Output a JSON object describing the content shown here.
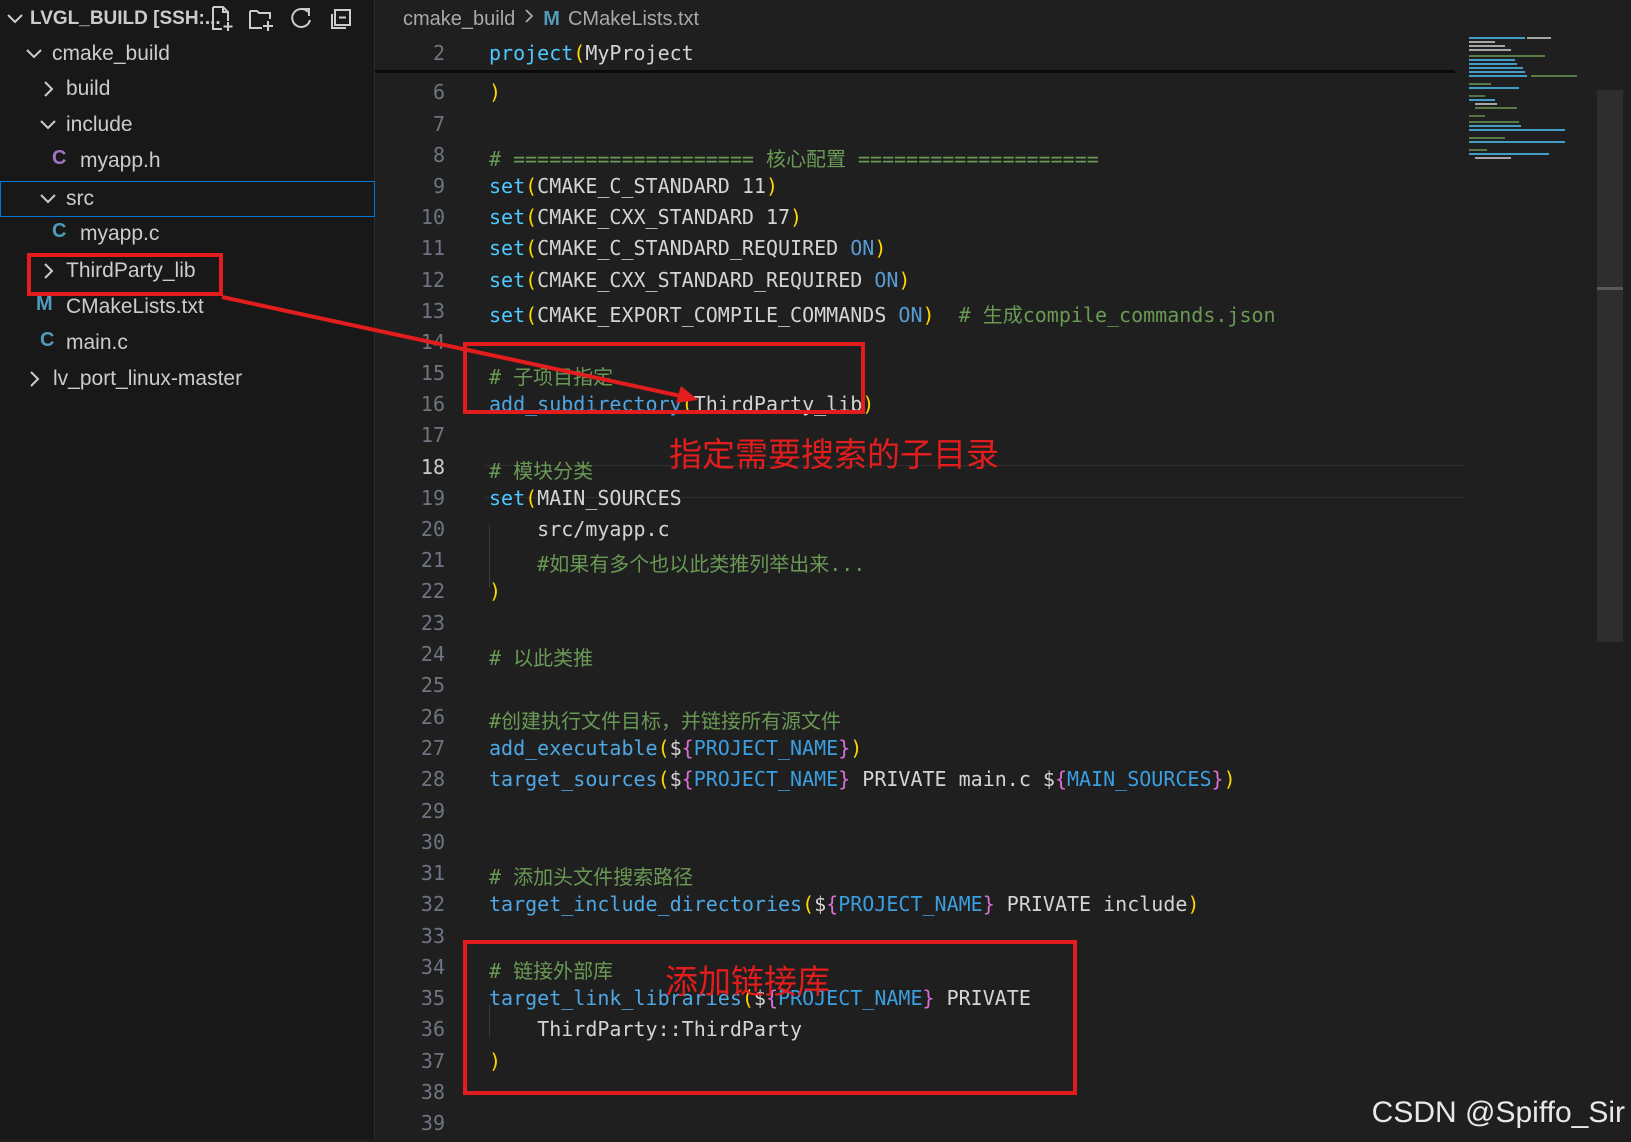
{
  "explorer": {
    "title": "LVGL_BUILD [SSH:...",
    "actions": [
      "new-file-icon",
      "new-folder-icon",
      "refresh-icon",
      "collapse-all-icon"
    ],
    "tree": [
      {
        "label": "cmake_build",
        "type": "folder",
        "expanded": true,
        "depth": 1
      },
      {
        "label": "build",
        "type": "folder",
        "expanded": false,
        "depth": 2
      },
      {
        "label": "include",
        "type": "folder",
        "expanded": true,
        "depth": 2
      },
      {
        "label": "myapp.h",
        "type": "file",
        "icon": "C",
        "icon_color": "#a074c4",
        "depth": 3
      },
      {
        "label": "src",
        "type": "folder",
        "expanded": true,
        "depth": 2,
        "selected": true
      },
      {
        "label": "myapp.c",
        "type": "file",
        "icon": "C",
        "icon_color": "#519aba",
        "depth": 3
      },
      {
        "label": "ThirdParty_lib",
        "type": "folder",
        "expanded": false,
        "depth": 2
      },
      {
        "label": "CMakeLists.txt",
        "type": "file",
        "icon": "M",
        "icon_color": "#519aba",
        "depth": 2
      },
      {
        "label": "main.c",
        "type": "file",
        "icon": "C",
        "icon_color": "#519aba",
        "depth": 2
      },
      {
        "label": "lv_port_linux-master",
        "type": "folder",
        "expanded": false,
        "depth": 1
      }
    ]
  },
  "editor": {
    "breadcrumb": [
      "cmake_build",
      "CMakeLists.txt"
    ],
    "breadcrumb_icon": "M",
    "active_line": "18",
    "lines": [
      {
        "n": "2",
        "text": "project(MyProject"
      },
      {
        "n": "6",
        "text": ")"
      },
      {
        "n": "7",
        "text": ""
      },
      {
        "n": "8",
        "text": "# ==================== 核心配置 ===================="
      },
      {
        "n": "9",
        "text": "set(CMAKE_C_STANDARD 11)"
      },
      {
        "n": "10",
        "text": "set(CMAKE_CXX_STANDARD 17)"
      },
      {
        "n": "11",
        "text": "set(CMAKE_C_STANDARD_REQUIRED ON)"
      },
      {
        "n": "12",
        "text": "set(CMAKE_CXX_STANDARD_REQUIRED ON)"
      },
      {
        "n": "13",
        "text": "set(CMAKE_EXPORT_COMPILE_COMMANDS ON)  # 生成compile_commands.json"
      },
      {
        "n": "14",
        "text": ""
      },
      {
        "n": "15",
        "text": "# 子项目指定"
      },
      {
        "n": "16",
        "text": "add_subdirectory(ThirdParty_lib)"
      },
      {
        "n": "17",
        "text": ""
      },
      {
        "n": "18",
        "text": "# 模块分类"
      },
      {
        "n": "19",
        "text": "set(MAIN_SOURCES"
      },
      {
        "n": "20",
        "text": "    src/myapp.c"
      },
      {
        "n": "21",
        "text": "    #如果有多个也以此类推列举出来..."
      },
      {
        "n": "22",
        "text": ")"
      },
      {
        "n": "23",
        "text": ""
      },
      {
        "n": "24",
        "text": "# 以此类推"
      },
      {
        "n": "25",
        "text": ""
      },
      {
        "n": "26",
        "text": "#创建执行文件目标，并链接所有源文件"
      },
      {
        "n": "27",
        "text": "add_executable(${PROJECT_NAME})"
      },
      {
        "n": "28",
        "text": "target_sources(${PROJECT_NAME} PRIVATE main.c ${MAIN_SOURCES})"
      },
      {
        "n": "29",
        "text": ""
      },
      {
        "n": "30",
        "text": ""
      },
      {
        "n": "31",
        "text": "# 添加头文件搜索路径"
      },
      {
        "n": "32",
        "text": "target_include_directories(${PROJECT_NAME} PRIVATE include)"
      },
      {
        "n": "33",
        "text": ""
      },
      {
        "n": "34",
        "text": "# 链接外部库"
      },
      {
        "n": "35",
        "text": "target_link_libraries(${PROJECT_NAME} PRIVATE"
      },
      {
        "n": "36",
        "text": "    ThirdParty::ThirdParty"
      },
      {
        "n": "37",
        "text": ")"
      },
      {
        "n": "38",
        "text": ""
      },
      {
        "n": "39",
        "text": ""
      }
    ]
  },
  "annotations": {
    "subdir_note": "指定需要搜索的子目录",
    "link_note": "添加链接库",
    "color": "#e31d1d"
  },
  "watermark": "CSDN @Spiffo_Sir"
}
